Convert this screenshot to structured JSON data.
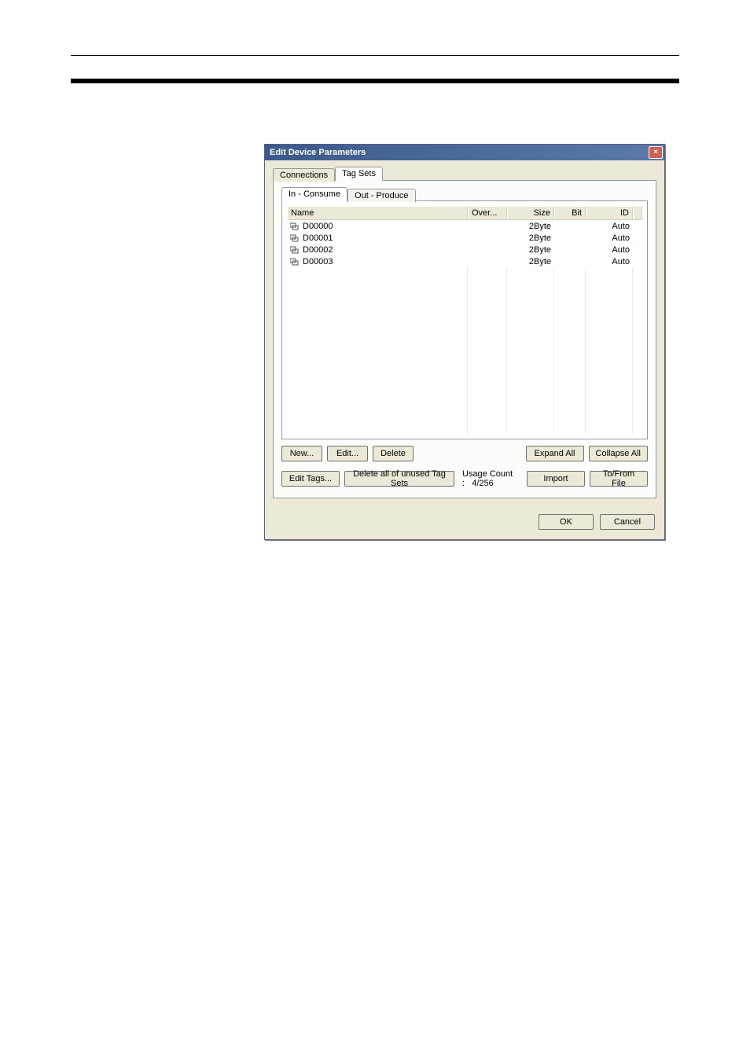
{
  "dialog": {
    "title": "Edit Device Parameters",
    "close_glyph": "×",
    "tabs": {
      "connections": "Connections",
      "tagsets": "Tag Sets"
    },
    "subtabs": {
      "in_consume": "In - Consume",
      "out_produce": "Out - Produce"
    },
    "columns": {
      "name": "Name",
      "over": "Over...",
      "size": "Size",
      "bit": "Bit",
      "id": "ID"
    },
    "rows": [
      {
        "name": "D00000",
        "over": "",
        "size": "2Byte",
        "bit": "",
        "id": "Auto"
      },
      {
        "name": "D00001",
        "over": "",
        "size": "2Byte",
        "bit": "",
        "id": "Auto"
      },
      {
        "name": "D00002",
        "over": "",
        "size": "2Byte",
        "bit": "",
        "id": "Auto"
      },
      {
        "name": "D00003",
        "over": "",
        "size": "2Byte",
        "bit": "",
        "id": "Auto"
      }
    ],
    "buttons": {
      "new": "New...",
      "edit": "Edit...",
      "delete": "Delete",
      "expand_all": "Expand All",
      "collapse_all": "Collapse All",
      "edit_tags": "Edit Tags...",
      "delete_unused": "Delete all of unused Tag Sets",
      "import": "Import",
      "to_from_file": "To/From File",
      "ok": "OK",
      "cancel": "Cancel"
    },
    "usage_label": "Usage Count :",
    "usage_value": "4/256"
  }
}
